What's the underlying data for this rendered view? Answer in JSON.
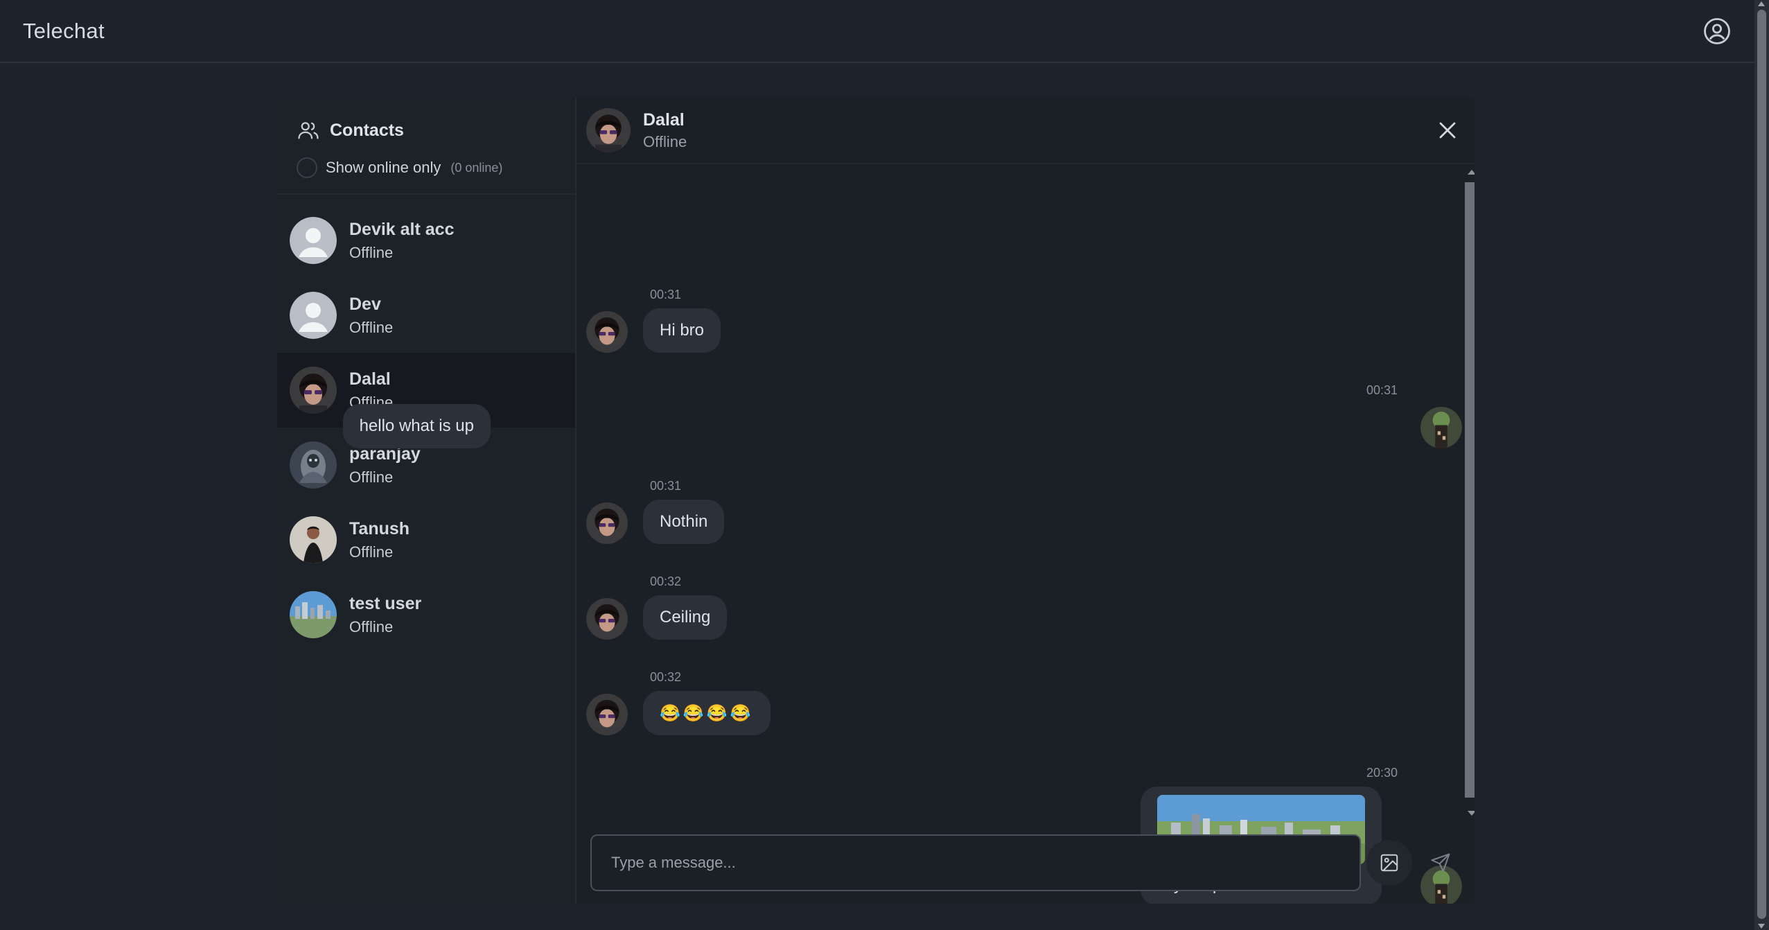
{
  "app": {
    "title": "Telechat"
  },
  "icons": {
    "profile": "user-circle-icon",
    "contacts": "users-icon",
    "close": "close-icon",
    "image": "image-icon",
    "send": "send-icon"
  },
  "sidebar": {
    "title": "Contacts",
    "online_toggle_label": "Show online only",
    "online_count": "(0 online)",
    "contacts": [
      {
        "name": "Devik alt acc",
        "status": "Offline",
        "avatar": "default-avatar"
      },
      {
        "name": "Dev",
        "status": "Offline",
        "avatar": "default-avatar"
      },
      {
        "name": "Dalal",
        "status": "Offline",
        "avatar": "photo-avatar",
        "active": true
      },
      {
        "name": "paranjay",
        "status": "Offline",
        "avatar": "photo-avatar"
      },
      {
        "name": "Tanush",
        "status": "Offline",
        "avatar": "photo-avatar"
      },
      {
        "name": "test user",
        "status": "Offline",
        "avatar": "photo-avatar"
      }
    ]
  },
  "chat": {
    "contact_name": "Dalal",
    "contact_status": "Offline",
    "messages": [
      {
        "time": "00:31",
        "text": "Hi bro",
        "from": "them"
      },
      {
        "time": "00:31",
        "text": "hello what is up",
        "from": "me"
      },
      {
        "time": "00:31",
        "text": "Nothin",
        "from": "them"
      },
      {
        "time": "00:32",
        "text": "Ceiling",
        "from": "them"
      },
      {
        "time": "00:32",
        "text": "😂😂😂😂",
        "from": "them"
      },
      {
        "time": "20:30",
        "text": "skyline pic.",
        "from": "me",
        "has_image": true
      }
    ],
    "input_placeholder": "Type a message..."
  },
  "colors": {
    "background": "#1e232b",
    "card": "#1b1f26",
    "bubble": "#2b3039",
    "active_contact": "#161a20"
  }
}
